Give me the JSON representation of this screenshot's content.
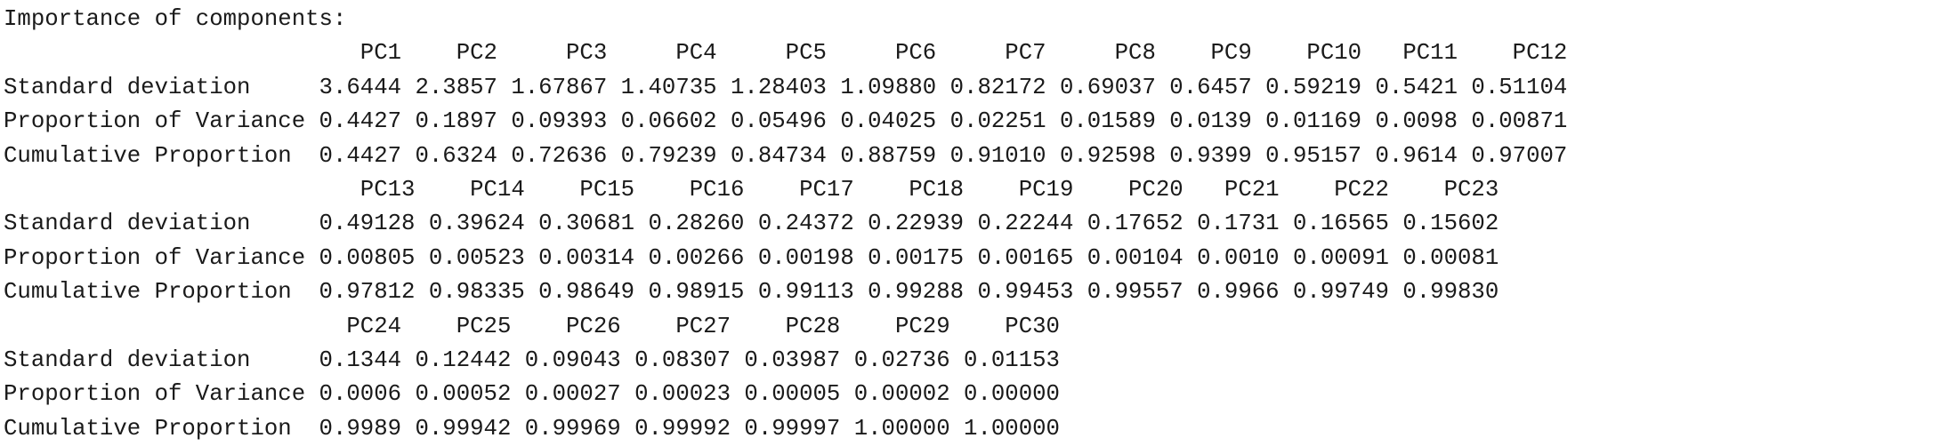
{
  "output": {
    "heading": "Importance of components:",
    "row_labels": {
      "sd": "Standard deviation",
      "prop": "Proportion of Variance",
      "cum": "Cumulative Proportion"
    },
    "blocks": [
      {
        "headers": [
          "PC1",
          "PC2",
          "PC3",
          "PC4",
          "PC5",
          "PC6",
          "PC7",
          "PC8",
          "PC9",
          "PC10",
          "PC11",
          "PC12"
        ],
        "standard_deviation": [
          "3.6444",
          "2.3857",
          "1.67867",
          "1.40735",
          "1.28403",
          "1.09880",
          "0.82172",
          "0.69037",
          "0.6457",
          "0.59219",
          "0.5421",
          "0.51104"
        ],
        "proportion_of_variance": [
          "0.4427",
          "0.1897",
          "0.09393",
          "0.06602",
          "0.05496",
          "0.04025",
          "0.02251",
          "0.01589",
          "0.0139",
          "0.01169",
          "0.0098",
          "0.00871"
        ],
        "cumulative_proportion": [
          "0.4427",
          "0.6324",
          "0.72636",
          "0.79239",
          "0.84734",
          "0.88759",
          "0.91010",
          "0.92598",
          "0.9399",
          "0.95157",
          "0.9614",
          "0.97007"
        ]
      },
      {
        "headers": [
          "PC13",
          "PC14",
          "PC15",
          "PC16",
          "PC17",
          "PC18",
          "PC19",
          "PC20",
          "PC21",
          "PC22",
          "PC23"
        ],
        "standard_deviation": [
          "0.49128",
          "0.39624",
          "0.30681",
          "0.28260",
          "0.24372",
          "0.22939",
          "0.22244",
          "0.17652",
          "0.1731",
          "0.16565",
          "0.15602"
        ],
        "proportion_of_variance": [
          "0.00805",
          "0.00523",
          "0.00314",
          "0.00266",
          "0.00198",
          "0.00175",
          "0.00165",
          "0.00104",
          "0.0010",
          "0.00091",
          "0.00081"
        ],
        "cumulative_proportion": [
          "0.97812",
          "0.98335",
          "0.98649",
          "0.98915",
          "0.99113",
          "0.99288",
          "0.99453",
          "0.99557",
          "0.9966",
          "0.99749",
          "0.99830"
        ]
      },
      {
        "headers": [
          "PC24",
          "PC25",
          "PC26",
          "PC27",
          "PC28",
          "PC29",
          "PC30"
        ],
        "standard_deviation": [
          "0.1344",
          "0.12442",
          "0.09043",
          "0.08307",
          "0.03987",
          "0.02736",
          "0.01153"
        ],
        "proportion_of_variance": [
          "0.0006",
          "0.00052",
          "0.00027",
          "0.00023",
          "0.00005",
          "0.00002",
          "0.00000"
        ],
        "cumulative_proportion": [
          "0.9989",
          "0.99942",
          "0.99969",
          "0.99992",
          "0.99997",
          "1.00000",
          "1.00000"
        ]
      }
    ]
  }
}
